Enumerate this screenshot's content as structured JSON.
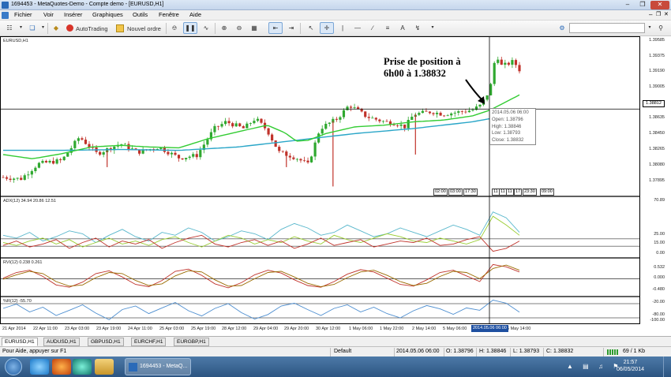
{
  "window": {
    "title": "1694453 - MetaQuotes-Demo - Compte demo - [EURUSD,H1]"
  },
  "menu": [
    "Fichier",
    "Voir",
    "Insérer",
    "Graphiques",
    "Outils",
    "Fenêtre",
    "Aide"
  ],
  "toolbar": {
    "autotrading_label": "AutoTrading",
    "new_order_label": "Nouvel ordre"
  },
  "main_chart": {
    "symbol_label": "EURUSD,H1",
    "price_ticks": [
      "1.39585",
      "1.39375",
      "1.39190",
      "1.39005",
      "1.38812",
      "1.38635",
      "1.38450",
      "1.38265",
      "1.38080",
      "1.37895"
    ],
    "current_price_tag": "1.38812",
    "annotation_line1": "Prise de position à",
    "annotation_line2": "6h00 à 1.38832",
    "session_markers_left": [
      "02:00",
      "03:00",
      "17:30"
    ],
    "session_markers_right": [
      "11",
      "11",
      "11",
      "17",
      "23:30",
      "09:00"
    ]
  },
  "tooltip": {
    "time": "2014.05.06 06:00",
    "open": "Open: 1.38796",
    "high": "High: 1.38846",
    "low": "Low: 1.38793",
    "close": "Close: 1.38832"
  },
  "adx": {
    "label": "ADX(12) 34.94 20.86 12.51",
    "ticks": [
      "70.89",
      "25.00",
      "15.00",
      "0.00"
    ]
  },
  "rvi": {
    "label": "RVI(12) 0.238 0.261",
    "ticks": [
      "0.532",
      "0.000",
      "-0.480"
    ]
  },
  "wpr": {
    "label": "%R(12) -55.70",
    "ticks": [
      "-20.00",
      "-80.00",
      "-100.00"
    ]
  },
  "time_axis": [
    "21 Apr 2014",
    "22 Apr 11:00",
    "23 Apr 03:00",
    "23 Apr 19:00",
    "24 Apr 11:00",
    "25 Apr 03:00",
    "25 Apr 19:00",
    "28 Apr 12:00",
    "29 Apr 04:00",
    "29 Apr 20:00",
    "30 Apr 12:00",
    "1 May 06:00",
    "1 May 22:00",
    "2 May 14:00",
    "5 May 06:00",
    "6 May 14:00"
  ],
  "time_cursor_label": "2014.05.06 06:00",
  "chart_tabs": [
    "EURUSD,H1",
    "AUDUSD,H1",
    "GBPUSD,H1",
    "EURCHF,H1",
    "EURGBP,H1"
  ],
  "status": {
    "help": "Pour Aide, appuyer sur F1",
    "profile": "Default",
    "time": "2014.05.06 06:00",
    "open": "O: 1.38796",
    "high": "H: 1.38846",
    "low": "L: 1.38793",
    "close": "C: 1.38832",
    "traffic": "69 / 1 Kb"
  },
  "taskbar": {
    "active_task": "1694453 - MetaQ...",
    "clock_time": "21:57",
    "clock_date": "06/05/2014"
  },
  "chart_data": [
    {
      "type": "candlestick",
      "title": "EURUSD,H1",
      "ylim": [
        1.378,
        1.3965
      ],
      "n_bars": 145,
      "anchors": [
        [
          0,
          1.38
        ],
        [
          6,
          1.3798
        ],
        [
          12,
          1.3816
        ],
        [
          20,
          1.382
        ],
        [
          26,
          1.3848
        ],
        [
          32,
          1.3828
        ],
        [
          40,
          1.384
        ],
        [
          46,
          1.383
        ],
        [
          53,
          1.3836
        ],
        [
          60,
          1.3823
        ],
        [
          66,
          1.3826
        ],
        [
          72,
          1.3858
        ],
        [
          76,
          1.3866
        ],
        [
          82,
          1.3858
        ],
        [
          86,
          1.387
        ],
        [
          90,
          1.3856
        ],
        [
          94,
          1.383
        ],
        [
          100,
          1.3823
        ],
        [
          104,
          1.3815
        ],
        [
          108,
          1.3858
        ],
        [
          114,
          1.387
        ],
        [
          118,
          1.3886
        ],
        [
          124,
          1.3872
        ],
        [
          130,
          1.3866
        ],
        [
          134,
          1.3864
        ],
        [
          137,
          1.386
        ],
        [
          140,
          1.3875
        ],
        [
          146,
          1.3878
        ],
        [
          150,
          1.3875
        ],
        [
          156,
          1.3878
        ],
        [
          160,
          1.388
        ],
        [
          163,
          1.3886
        ],
        [
          166,
          1.3905
        ],
        [
          168,
          1.3948
        ],
        [
          170,
          1.3932
        ],
        [
          174,
          1.3938
        ],
        [
          176,
          1.3928
        ]
      ],
      "ema_fast": [
        [
          0,
          1.3827
        ],
        [
          10,
          1.3822
        ],
        [
          20,
          1.3828
        ],
        [
          30,
          1.3836
        ],
        [
          40,
          1.3838
        ],
        [
          50,
          1.3836
        ],
        [
          60,
          1.3835
        ],
        [
          70,
          1.3846
        ],
        [
          80,
          1.3854
        ],
        [
          90,
          1.3862
        ],
        [
          96,
          1.3853
        ],
        [
          100,
          1.3843
        ],
        [
          104,
          1.3844
        ],
        [
          110,
          1.3852
        ],
        [
          120,
          1.386
        ],
        [
          130,
          1.3862
        ],
        [
          140,
          1.3866
        ],
        [
          150,
          1.3868
        ],
        [
          160,
          1.3873
        ],
        [
          166,
          1.388
        ],
        [
          176,
          1.3898
        ]
      ],
      "ema_slow": [
        [
          0,
          1.3832
        ],
        [
          20,
          1.3832
        ],
        [
          40,
          1.3833
        ],
        [
          60,
          1.3832
        ],
        [
          80,
          1.3836
        ],
        [
          100,
          1.3844
        ],
        [
          120,
          1.3852
        ],
        [
          140,
          1.3858
        ],
        [
          160,
          1.3866
        ],
        [
          176,
          1.3876
        ]
      ]
    },
    {
      "type": "line",
      "title": "ADX(12)",
      "ylim": [
        0,
        80
      ],
      "series": [
        {
          "name": "ADX",
          "values": [
            30,
            26,
            34,
            22,
            28,
            36,
            32,
            20,
            30,
            38,
            28,
            22,
            34,
            30,
            40,
            34,
            22,
            28,
            36,
            32,
            24,
            38,
            46,
            40,
            30,
            34,
            44,
            36,
            28,
            32,
            40,
            34,
            28,
            36,
            44,
            38,
            30,
            62,
            54,
            34
          ]
        },
        {
          "name": "+DI",
          "values": [
            20,
            16,
            22,
            26,
            18,
            24,
            14,
            20,
            26,
            18,
            22,
            16,
            24,
            28,
            20,
            14,
            22,
            30,
            26,
            18,
            24,
            20,
            28,
            22,
            18,
            30,
            24,
            20,
            26,
            32,
            28,
            22,
            20,
            26,
            22,
            18,
            24,
            56,
            44,
            30
          ]
        },
        {
          "name": "-DI",
          "values": [
            16,
            22,
            14,
            18,
            24,
            12,
            20,
            26,
            14,
            22,
            18,
            24,
            12,
            20,
            26,
            30,
            18,
            14,
            20,
            24,
            16,
            22,
            12,
            18,
            26,
            16,
            20,
            24,
            14,
            18,
            22,
            20,
            26,
            16,
            18,
            24,
            28,
            8,
            12,
            22
          ]
        }
      ]
    },
    {
      "type": "line",
      "title": "RVI(12)",
      "ylim": [
        -0.6,
        0.65
      ],
      "series": [
        {
          "name": "RVI",
          "values": [
            0.02,
            0.22,
            0.3,
            0.08,
            -0.22,
            -0.3,
            -0.12,
            0.18,
            0.28,
            0.06,
            -0.2,
            -0.28,
            -0.06,
            0.26,
            0.34,
            0.12,
            -0.18,
            -0.32,
            -0.14,
            0.14,
            0.3,
            0.2,
            -0.04,
            -0.24,
            -0.3,
            -0.1,
            0.16,
            0.32,
            0.24,
            0.02,
            -0.2,
            -0.26,
            -0.04,
            0.22,
            0.3,
            0.1,
            -0.1,
            0.5,
            0.42,
            0.24
          ]
        },
        {
          "name": "Signal",
          "values": [
            -0.02,
            0.14,
            0.26,
            0.18,
            -0.1,
            -0.26,
            -0.22,
            0.04,
            0.22,
            0.18,
            -0.06,
            -0.24,
            -0.18,
            0.1,
            0.28,
            0.24,
            -0.04,
            -0.26,
            -0.24,
            0.0,
            0.22,
            0.26,
            0.06,
            -0.16,
            -0.28,
            -0.2,
            0.04,
            0.24,
            0.3,
            0.12,
            -0.1,
            -0.24,
            -0.16,
            0.08,
            0.26,
            0.22,
            0.0,
            0.36,
            0.48,
            0.3
          ]
        }
      ]
    },
    {
      "type": "line",
      "title": "%R(12)",
      "ylim": [
        -100,
        0
      ],
      "series": [
        {
          "name": "%R",
          "values": [
            -40,
            -22,
            -55,
            -35,
            -70,
            -48,
            -25,
            -60,
            -88,
            -45,
            -30,
            -62,
            -38,
            -15,
            -50,
            -72,
            -40,
            -20,
            -58,
            -85,
            -66,
            -30,
            -18,
            -45,
            -70,
            -40,
            -25,
            -55,
            -35,
            -62,
            -80,
            -50,
            -28,
            -42,
            -65,
            -38,
            -48,
            -5,
            -18,
            -56
          ]
        }
      ]
    }
  ]
}
